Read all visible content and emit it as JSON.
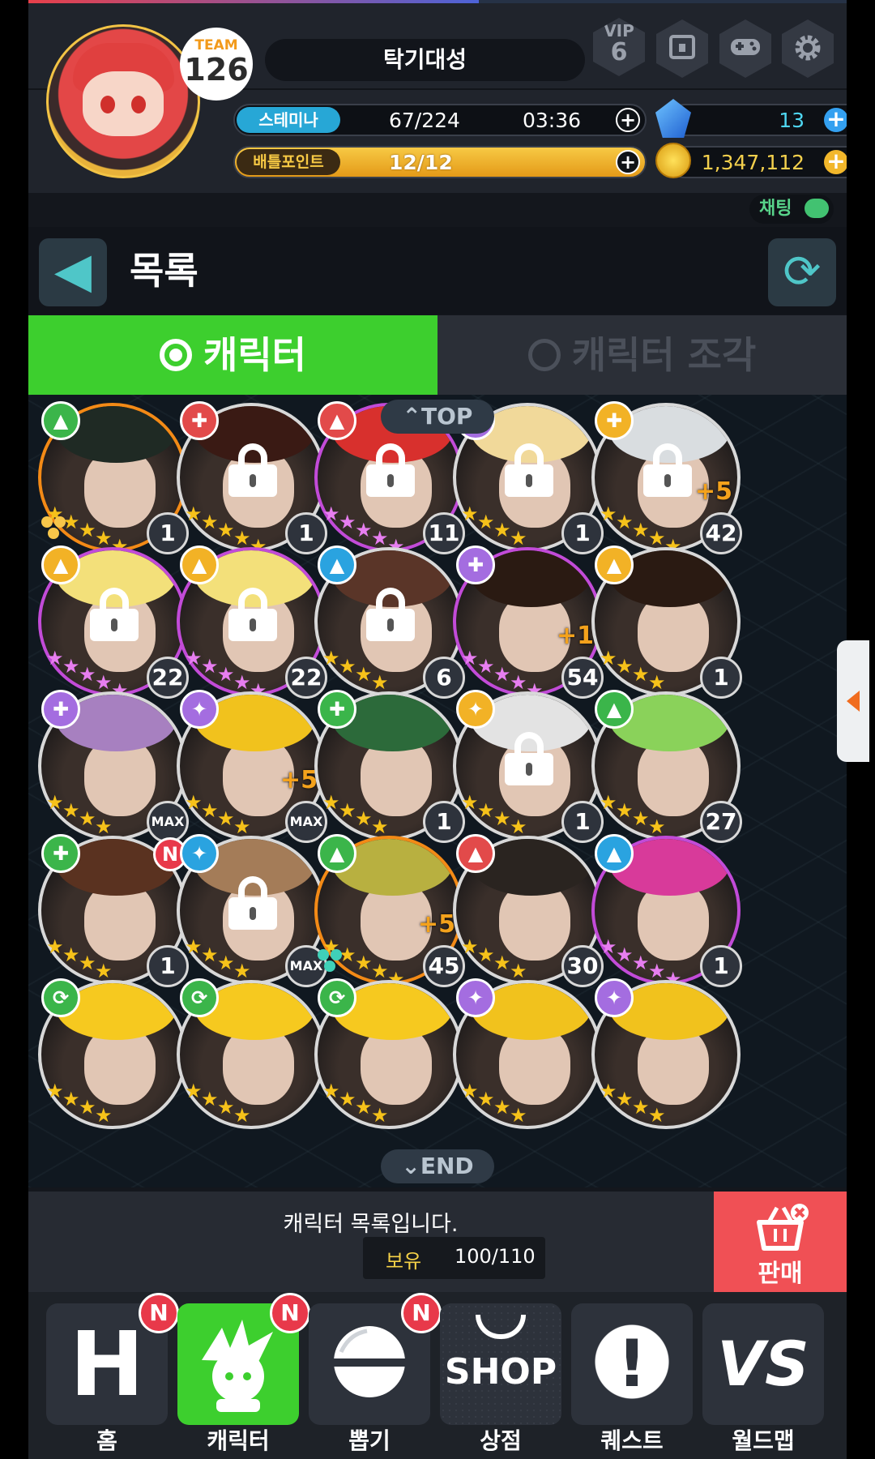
{
  "header": {
    "team_label": "TEAM",
    "team_level": "126",
    "player_name": "탁기대성",
    "vip_label": "VIP",
    "vip_level": "6",
    "stamina_label": "스테미나",
    "stamina_value": "67/224",
    "stamina_timer": "03:36",
    "gems": "13",
    "battle_points_label": "배틀포인트",
    "battle_points_value": "12/12",
    "gold": "1,347,112",
    "chat_label": "채팅",
    "top_progress": 0.55
  },
  "titlebar": {
    "back_icon": "◀",
    "title": "목록",
    "refresh_icon": "⟳"
  },
  "tabs": [
    {
      "label": "캐릭터",
      "active": true
    },
    {
      "label": "캐릭터 조각",
      "active": false
    }
  ],
  "scroll_top_label": "⌃TOP",
  "scroll_end_label": "⌄END",
  "characters": [
    {
      "level": "1",
      "element": "green",
      "locked": false,
      "frame": "orange",
      "stars": 5,
      "hair": "#1f2a24",
      "plus": "",
      "new": false
    },
    {
      "level": "1",
      "element": "red-shield",
      "locked": true,
      "frame": "white",
      "stars": 5,
      "hair": "#3a1a14",
      "plus": "",
      "new": false
    },
    {
      "level": "11",
      "element": "red",
      "locked": true,
      "frame": "purple",
      "stars": 5,
      "hair": "#d8302d",
      "plus": "",
      "new": false
    },
    {
      "level": "1",
      "element": "purple",
      "locked": true,
      "frame": "white",
      "stars": 4,
      "hair": "#f1d99a",
      "plus": "",
      "new": false
    },
    {
      "level": "42",
      "element": "yellow-shield",
      "locked": true,
      "frame": "white",
      "stars": 5,
      "hair": "#d9dde0",
      "plus": "+5",
      "new": false
    },
    {
      "level": "22",
      "element": "yellow",
      "locked": true,
      "frame": "purple",
      "stars": 5,
      "hair": "#f3e07a",
      "plus": "",
      "new": false
    },
    {
      "level": "22",
      "element": "yellow",
      "locked": true,
      "frame": "purple",
      "stars": 5,
      "hair": "#f3e07a",
      "plus": "",
      "new": false
    },
    {
      "level": "6",
      "element": "blue",
      "locked": true,
      "frame": "white",
      "stars": 4,
      "hair": "#5a3528",
      "plus": "",
      "new": false
    },
    {
      "level": "54",
      "element": "purple-shield",
      "locked": false,
      "frame": "purple",
      "stars": 5,
      "hair": "#2a1a12",
      "plus": "+1",
      "new": false
    },
    {
      "level": "1",
      "element": "yellow",
      "locked": false,
      "frame": "white",
      "stars": 4,
      "hair": "#2a1a12",
      "plus": "",
      "new": false
    },
    {
      "level": "MAX",
      "element": "purple-shield",
      "locked": false,
      "frame": "white",
      "stars": 4,
      "hair": "#a780c0",
      "plus": "",
      "new": false
    },
    {
      "level": "MAX",
      "element": "purple-wand",
      "locked": false,
      "frame": "white",
      "stars": 4,
      "hair": "#f1c21d",
      "plus": "+5",
      "new": false
    },
    {
      "level": "1",
      "element": "green-shield",
      "locked": false,
      "frame": "white",
      "stars": 4,
      "hair": "#2c6a3a",
      "plus": "",
      "new": false
    },
    {
      "level": "1",
      "element": "yellow-wand",
      "locked": true,
      "frame": "white",
      "stars": 4,
      "hair": "#e3e3e3",
      "plus": "",
      "new": false
    },
    {
      "level": "27",
      "element": "green",
      "locked": false,
      "frame": "white",
      "stars": 4,
      "hair": "#8ad25a",
      "plus": "",
      "new": false
    },
    {
      "level": "1",
      "element": "green-cross",
      "locked": false,
      "frame": "white",
      "stars": 4,
      "hair": "#5a3220",
      "plus": "",
      "new": true
    },
    {
      "level": "MAX",
      "element": "blue-wand",
      "locked": true,
      "frame": "white",
      "stars": 4,
      "hair": "#a47c58",
      "plus": "",
      "new": false
    },
    {
      "level": "45",
      "element": "green",
      "locked": false,
      "frame": "orange",
      "stars": 5,
      "hair": "#b8b040",
      "plus": "+5",
      "new": false
    },
    {
      "level": "30",
      "element": "red",
      "locked": false,
      "frame": "white",
      "stars": 4,
      "hair": "#2a2420",
      "plus": "",
      "new": false
    },
    {
      "level": "1",
      "element": "blue",
      "locked": false,
      "frame": "purple",
      "stars": 5,
      "hair": "#d83a9a",
      "plus": "",
      "new": false
    },
    {
      "level": "",
      "element": "green-cycle",
      "locked": false,
      "frame": "white",
      "stars": 4,
      "hair": "#f6c91f",
      "plus": "",
      "new": false
    },
    {
      "level": "",
      "element": "green-cycle",
      "locked": false,
      "frame": "white",
      "stars": 4,
      "hair": "#f6c91f",
      "plus": "",
      "new": false
    },
    {
      "level": "",
      "element": "green-cycle",
      "locked": false,
      "frame": "white",
      "stars": 4,
      "hair": "#f6c91f",
      "plus": "",
      "new": false
    },
    {
      "level": "",
      "element": "purple-wand",
      "locked": false,
      "frame": "white",
      "stars": 4,
      "hair": "#f1c21d",
      "plus": "",
      "new": false
    },
    {
      "level": "",
      "element": "purple-wand",
      "locked": false,
      "frame": "white",
      "stars": 4,
      "hair": "#f1c21d",
      "plus": "",
      "new": false
    }
  ],
  "info": {
    "message": "캐릭터 목록입니다.",
    "owned_label": "보유",
    "owned_value": "100/110",
    "sell_label": "판매"
  },
  "nav": [
    {
      "label": "홈",
      "new": true,
      "icon": "home-icon",
      "glyph": "H"
    },
    {
      "label": "캐릭터",
      "new": true,
      "icon": "character-icon",
      "glyph": ""
    },
    {
      "label": "뽑기",
      "new": true,
      "icon": "capsule-icon",
      "glyph": ""
    },
    {
      "label": "상점",
      "new": false,
      "icon": "shop-icon",
      "glyph": "SHOP"
    },
    {
      "label": "퀘스트",
      "new": false,
      "icon": "quest-icon",
      "glyph": "!"
    },
    {
      "label": "월드맵",
      "new": false,
      "icon": "worldmap-icon",
      "glyph": "VS"
    }
  ],
  "new_badge": "N",
  "colors": {
    "accent_green": "#3dcf2e",
    "sell_red": "#f05055",
    "elem_green": "#3bb54a",
    "elem_red": "#e24a4a",
    "elem_blue": "#2aa3e0",
    "elem_yellow": "#f2b226",
    "elem_purple": "#a46de0"
  }
}
